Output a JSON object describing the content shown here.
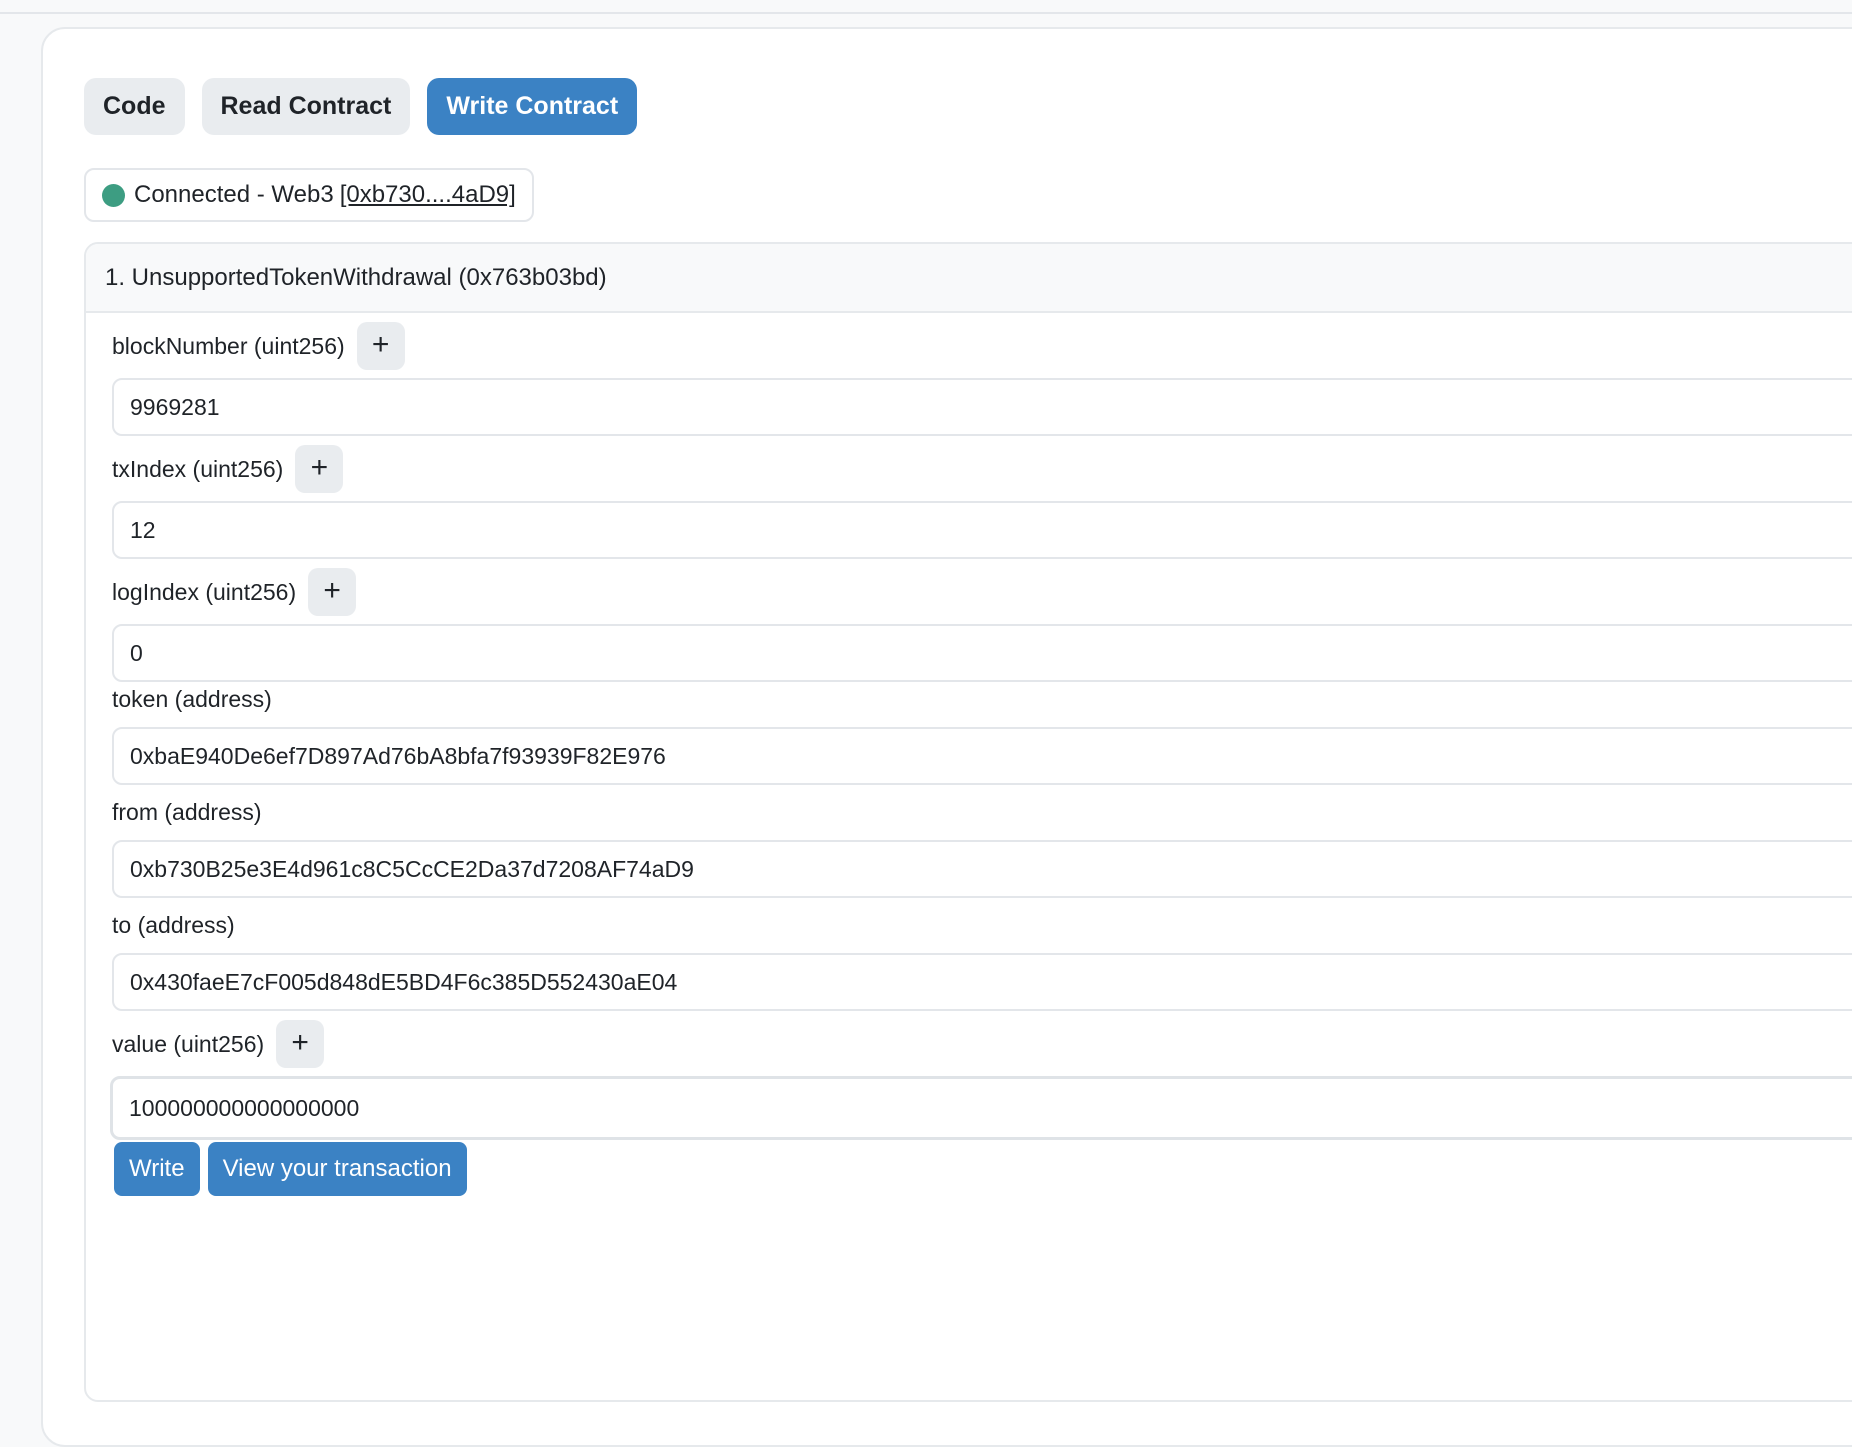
{
  "tabs": [
    {
      "label": "Code",
      "active": false
    },
    {
      "label": "Read Contract",
      "active": false
    },
    {
      "label": "Write Contract",
      "active": true
    }
  ],
  "status": {
    "text": "Connected - Web3",
    "address": "[0xb730....4aD9]",
    "color": "#3d9d82"
  },
  "method": {
    "title": "1. UnsupportedTokenWithdrawal (0x763b03bd)",
    "fields": [
      {
        "label": "blockNumber (uint256)",
        "value": "9969281",
        "has_plus": true
      },
      {
        "label": "txIndex (uint256)",
        "value": "12",
        "has_plus": true
      },
      {
        "label": "logIndex (uint256)",
        "value": "0",
        "has_plus": true
      },
      {
        "label": "token (address)",
        "value": "0xbaE940De6ef7D897Ad76bA8bfa7f93939F82E976",
        "has_plus": false
      },
      {
        "label": "from (address)",
        "value": "0xb730B25e3E4d961c8C5CcCE2Da37d7208AF74aD9",
        "has_plus": false
      },
      {
        "label": "to (address)",
        "value": "0x430faeE7cF005d848dE5BD4F6c385D552430aE04",
        "has_plus": false
      },
      {
        "label": "value (uint256)",
        "value": "100000000000000000",
        "has_plus": true
      }
    ],
    "plus_glyph": "+",
    "write_label": "Write",
    "view_tx_label": "View your transaction"
  },
  "colors": {
    "primary": "#3b82c4",
    "tab_bg": "#e9ecef"
  }
}
